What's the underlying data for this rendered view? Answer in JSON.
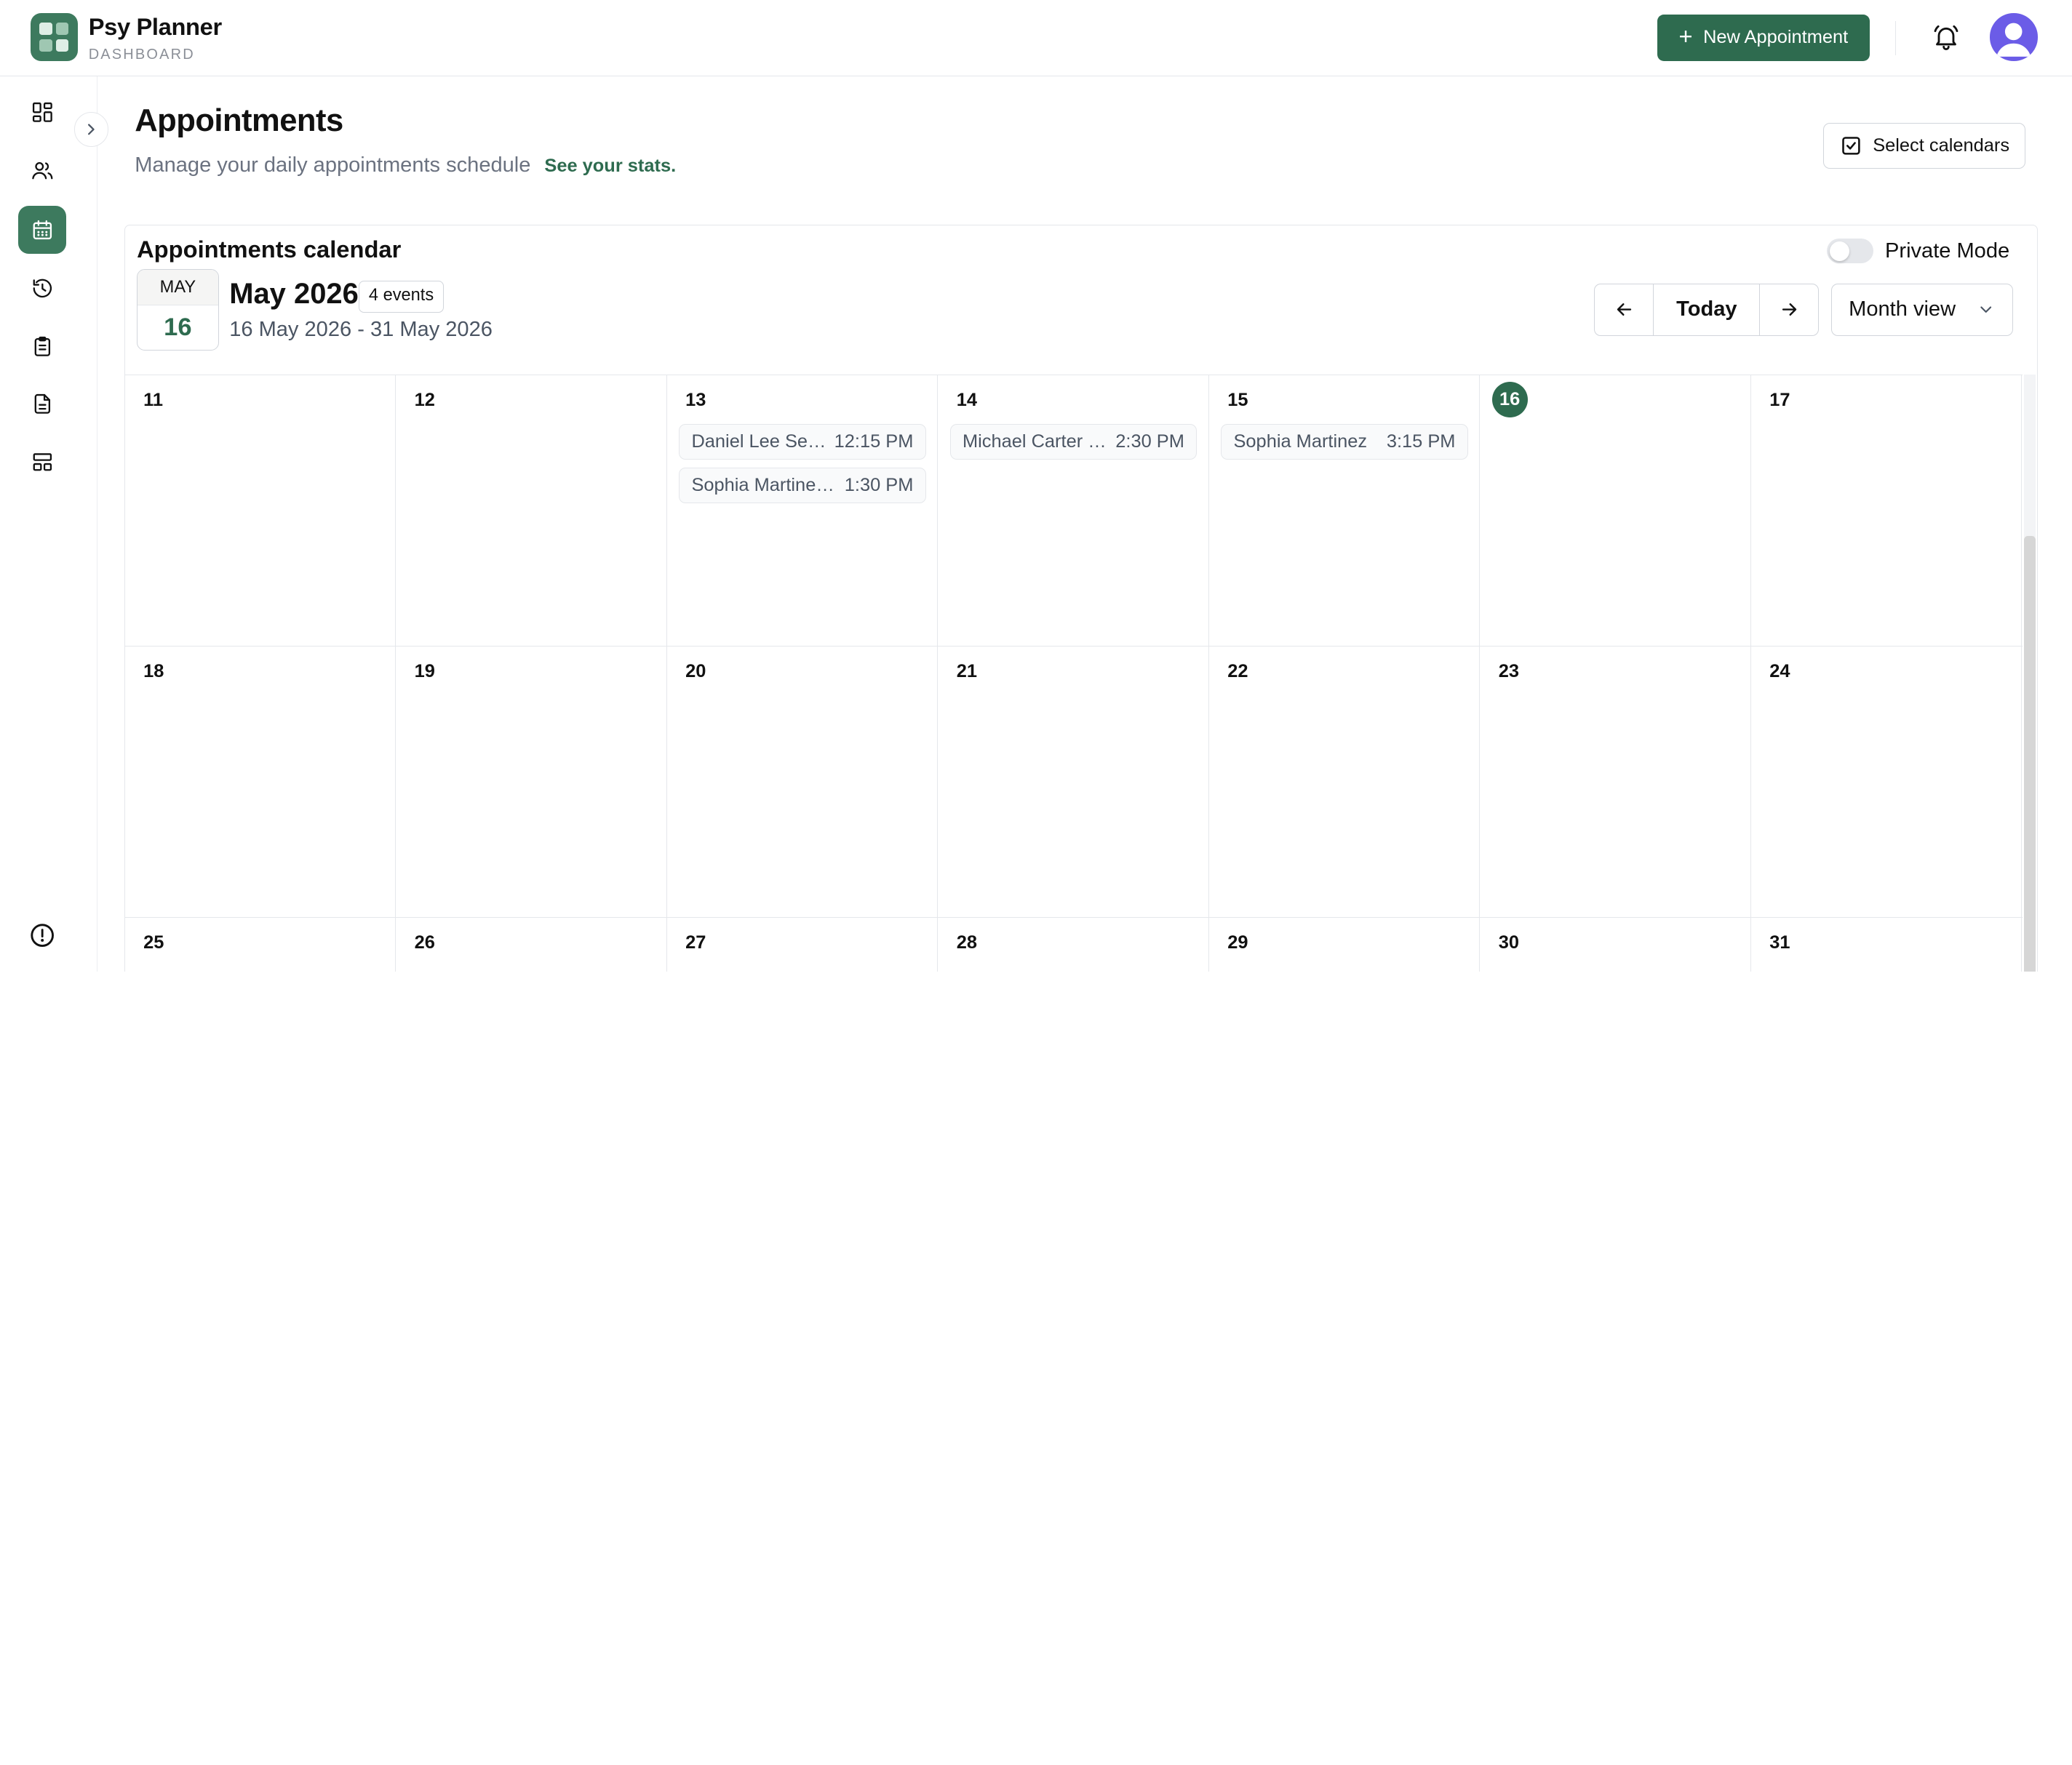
{
  "header": {
    "brand_title": "Psy Planner",
    "brand_sub": "DASHBOARD",
    "new_appointment_label": "New Appointment"
  },
  "sidebar": {
    "items": [
      {
        "name": "dashboard-icon"
      },
      {
        "name": "users-icon"
      },
      {
        "name": "calendar-icon",
        "active": true
      },
      {
        "name": "history-icon"
      },
      {
        "name": "clipboard-icon"
      },
      {
        "name": "document-icon"
      },
      {
        "name": "layout-icon"
      }
    ],
    "footer_icon": "info-icon"
  },
  "page": {
    "title": "Appointments",
    "subtitle": "Manage your daily appointments schedule",
    "stats_link": "See your stats.",
    "select_calendars_label": "Select calendars"
  },
  "calendar": {
    "card_title": "Appointments calendar",
    "private_mode_label": "Private Mode",
    "private_mode_on": false,
    "badge_month": "MAY",
    "badge_day": "16",
    "month_title": "May 2026",
    "events_count": "4 events",
    "range": "16 May 2026 - 31 May 2026",
    "today_label": "Today",
    "view_label": "Month view",
    "accent_color": "#2e6b4f",
    "weeks": [
      [
        {
          "day": "11",
          "events": []
        },
        {
          "day": "12",
          "events": []
        },
        {
          "day": "13",
          "events": [
            {
              "name": "Daniel Lee Session",
              "time": "12:15 PM"
            },
            {
              "name": "Sophia Martinez Session",
              "time": "1:30 PM"
            }
          ]
        },
        {
          "day": "14",
          "events": [
            {
              "name": "Michael Carter Session",
              "time": "2:30 PM"
            }
          ]
        },
        {
          "day": "15",
          "events": [
            {
              "name": "Sophia Martinez",
              "time": "3:15 PM"
            }
          ]
        },
        {
          "day": "16",
          "events": [],
          "today": true
        },
        {
          "day": "17",
          "events": []
        }
      ],
      [
        {
          "day": "18",
          "events": []
        },
        {
          "day": "19",
          "events": []
        },
        {
          "day": "20",
          "events": []
        },
        {
          "day": "21",
          "events": []
        },
        {
          "day": "22",
          "events": []
        },
        {
          "day": "23",
          "events": []
        },
        {
          "day": "24",
          "events": []
        }
      ],
      [
        {
          "day": "25",
          "events": []
        },
        {
          "day": "26",
          "events": []
        },
        {
          "day": "27",
          "events": []
        },
        {
          "day": "28",
          "events": []
        },
        {
          "day": "29",
          "events": []
        },
        {
          "day": "30",
          "events": []
        },
        {
          "day": "31",
          "events": []
        }
      ]
    ]
  }
}
